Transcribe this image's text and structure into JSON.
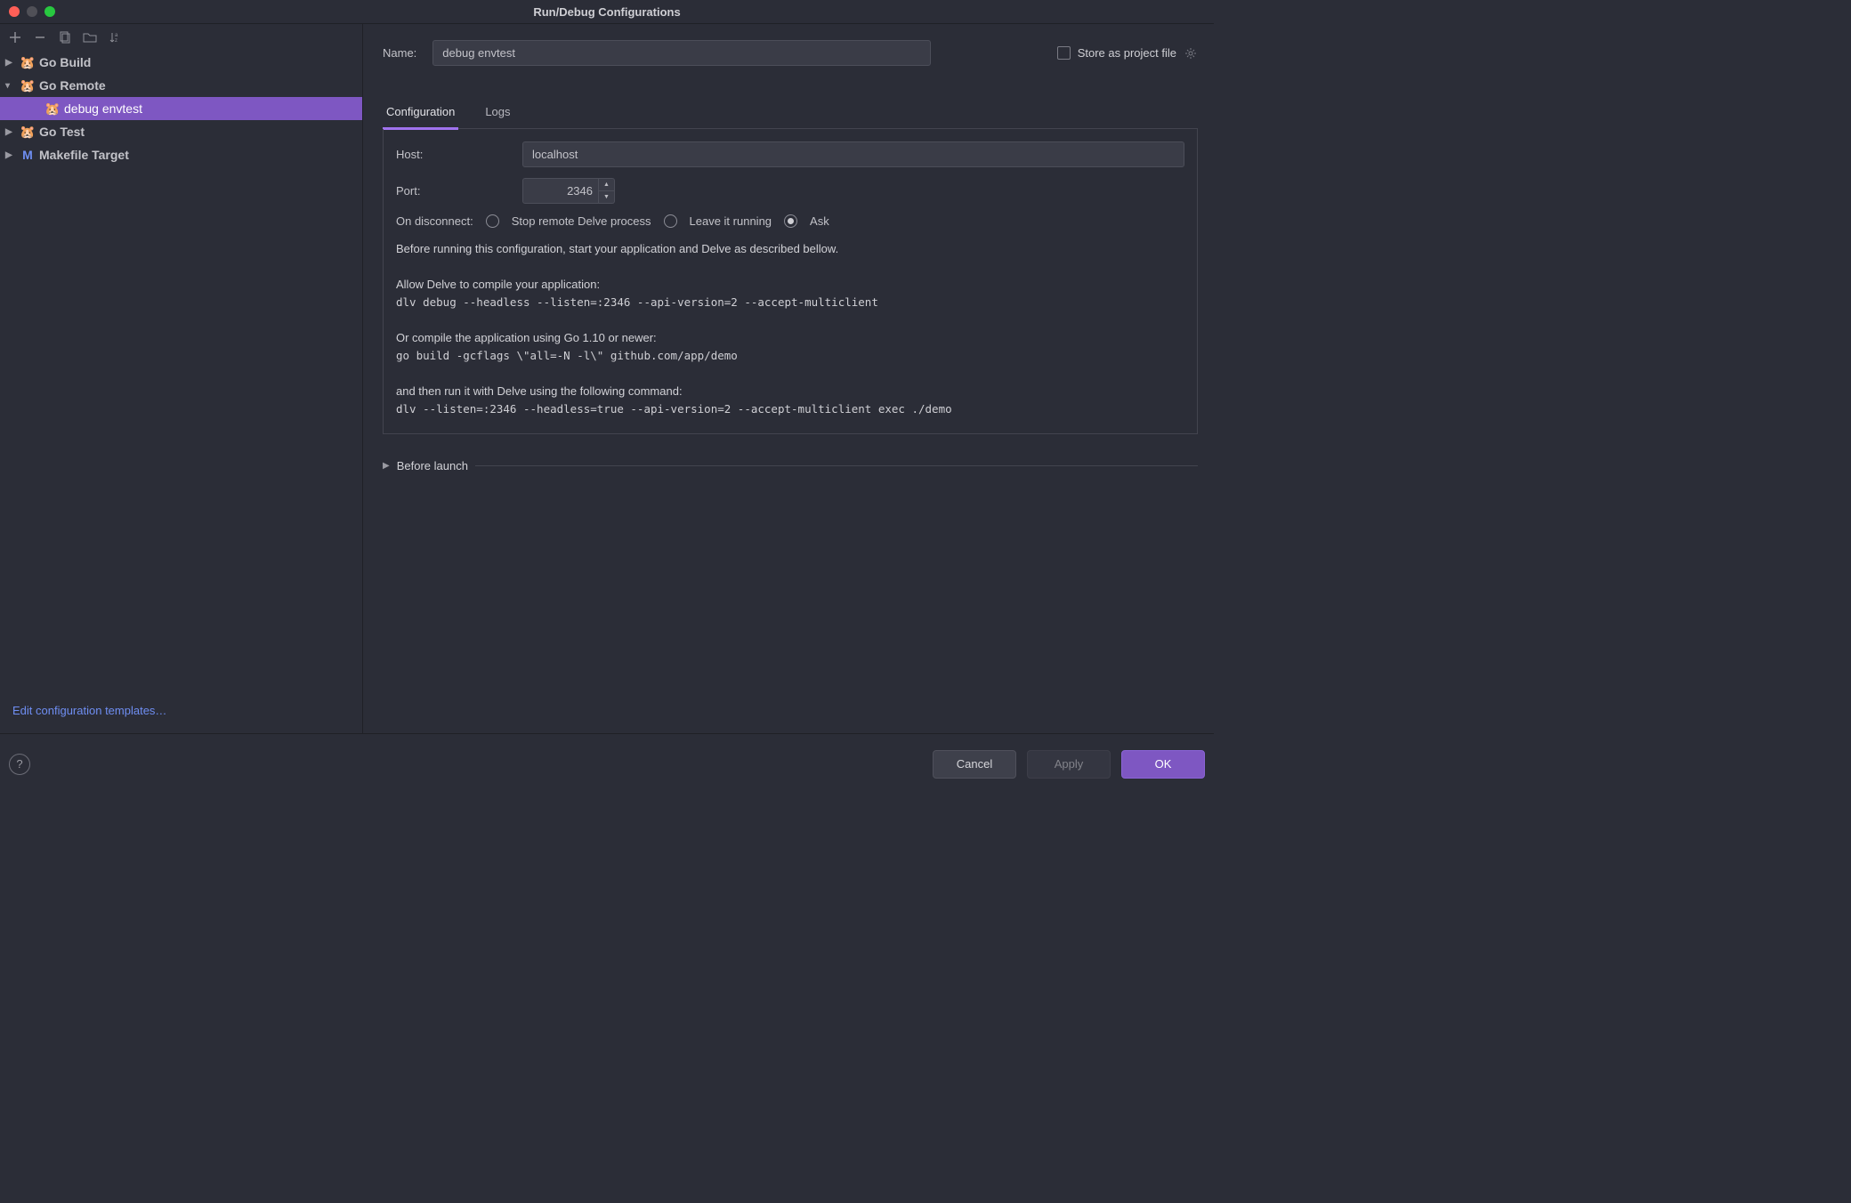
{
  "window": {
    "title": "Run/Debug Configurations"
  },
  "sidebar": {
    "items": [
      {
        "label": "Go Build",
        "expanded": false
      },
      {
        "label": "Go Remote",
        "expanded": true,
        "children": [
          {
            "label": "debug envtest",
            "selected": true
          }
        ]
      },
      {
        "label": "Go Test",
        "expanded": false
      },
      {
        "label": "Makefile Target",
        "expanded": false
      }
    ],
    "edit_templates": "Edit configuration templates…"
  },
  "form": {
    "name_label": "Name:",
    "name_value": "debug envtest",
    "store_label": "Store as project file",
    "tabs": {
      "configuration": "Configuration",
      "logs": "Logs"
    },
    "host_label": "Host:",
    "host_value": "localhost",
    "port_label": "Port:",
    "port_value": "2346",
    "disconnect_label": "On disconnect:",
    "disconnect_options": {
      "stop": "Stop remote Delve process",
      "leave": "Leave it running",
      "ask": "Ask"
    },
    "help_line": "Before running this configuration, start your application and Delve as described bellow.",
    "allow_line": "Allow Delve to compile your application:",
    "cmd1": "dlv debug --headless --listen=:2346 --api-version=2 --accept-multiclient",
    "or_line": "Or compile the application using Go 1.10 or newer:",
    "cmd2": "go build -gcflags \\\"all=-N -l\\\" github.com/app/demo",
    "then_line": "and then run it with Delve using the following command:",
    "cmd3": "dlv --listen=:2346 --headless=true --api-version=2 --accept-multiclient exec ./demo",
    "before_launch": "Before launch"
  },
  "buttons": {
    "cancel": "Cancel",
    "apply": "Apply",
    "ok": "OK",
    "help": "?"
  }
}
